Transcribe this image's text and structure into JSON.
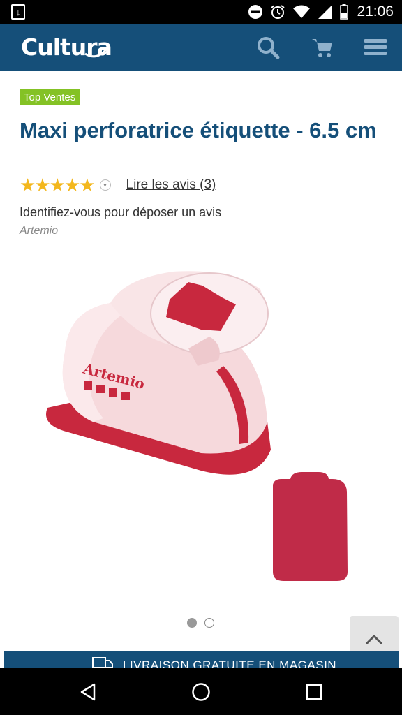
{
  "status_bar": {
    "time": "21:06",
    "icons": [
      "download-notification-icon",
      "do-not-disturb-icon",
      "alarm-icon",
      "wifi-icon",
      "signal-icon",
      "battery-icon"
    ]
  },
  "app_bar": {
    "logo": "Cultura",
    "icons": [
      "search-icon",
      "cart-icon",
      "menu-icon"
    ]
  },
  "product": {
    "badge": "Top Ventes",
    "title": "Maxi perforatrice étiquette - 6.5 cm",
    "rating_stars": "★★★★★",
    "rating_value": 5,
    "reviews_link": "Lire les avis (3)",
    "login_prompt": "Identifiez-vous pour déposer un avis",
    "brand": "Artemio",
    "image_brand_text": "Artemio"
  },
  "gallery": {
    "dot_count": 2,
    "active_index": 0
  },
  "banner": {
    "text": "LIVRAISON GRATUITE EN MAGASIN"
  },
  "colors": {
    "brand_blue": "#154f79",
    "badge_green": "#84c225",
    "star_gold": "#f3b71d",
    "product_red": "#c8283e"
  }
}
